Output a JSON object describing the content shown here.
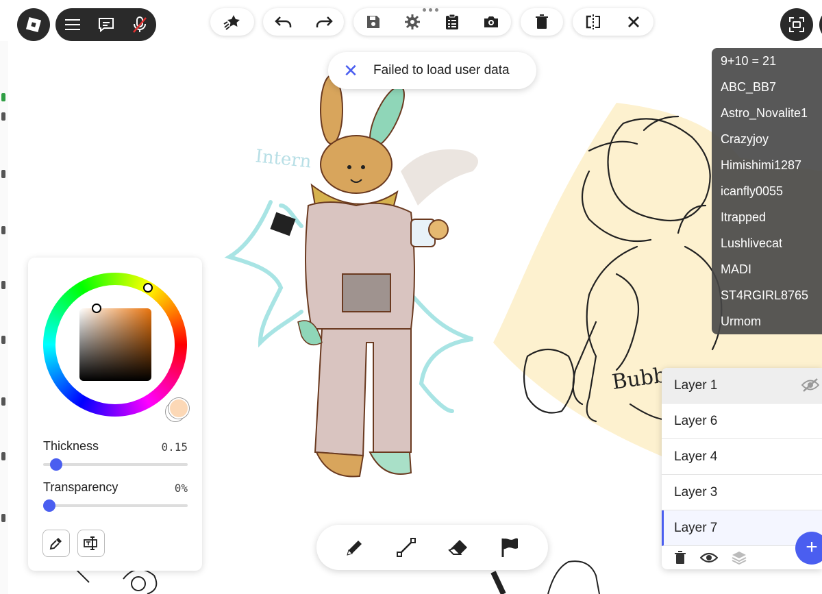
{
  "topbar": {
    "menu_icon": "hamburger-icon",
    "chat_icon": "chat-icon",
    "mic_icon": "mic-muted-icon"
  },
  "toolbar": {
    "groups": [
      [
        "sparkle-icon"
      ],
      [
        "undo-icon",
        "redo-icon"
      ],
      [
        "save-icon",
        "settings-icon",
        "clipboard-icon",
        "camera-icon"
      ],
      [
        "trash-icon"
      ],
      [
        "mirror-icon",
        "close-icon"
      ]
    ]
  },
  "toast": {
    "message": "Failed to load user data"
  },
  "players": [
    "9+10 = 21",
    "ABC_BB7",
    "Astro_Novalite1",
    "Crazyjoy",
    "Himishimi1287",
    "icanfly0055",
    "Itrapped",
    "Lushlivecat",
    "MADI",
    "ST4RGIRL8765",
    "Urmom"
  ],
  "color_panel": {
    "thickness_label": "Thickness",
    "thickness_value": "0.15",
    "thickness_level": 0.05,
    "transparency_label": "Transparency",
    "transparency_value": "0%",
    "transparency_level": 0,
    "selected_color": "#fcd8b6",
    "hue_color": "#e8740e"
  },
  "layers": [
    {
      "name": "Layer 1",
      "hidden": true
    },
    {
      "name": "Layer 6"
    },
    {
      "name": "Layer 4"
    },
    {
      "name": "Layer 3"
    },
    {
      "name": "Layer 7",
      "active": true
    }
  ],
  "bottom_tools": [
    "pencil-icon",
    "line-icon",
    "eraser-icon",
    "flag-icon"
  ],
  "canvas_text": {
    "intern": "Intern",
    "bubble": "Bubb"
  },
  "colors": {
    "accent": "#4a5ef0",
    "dark": "#2a2a2a"
  }
}
